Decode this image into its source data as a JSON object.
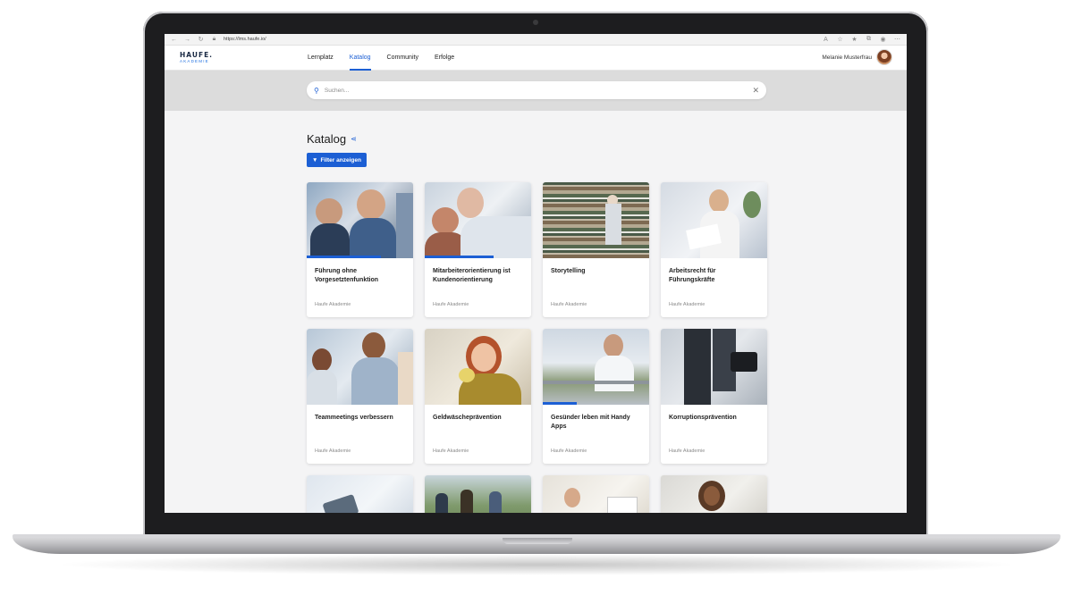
{
  "browser": {
    "url": "https://lms.haufe.io/"
  },
  "header": {
    "logo_top": "HAUFE.",
    "logo_bottom": "AKADEMIE",
    "nav": [
      {
        "label": "Lernplatz",
        "active": false
      },
      {
        "label": "Katalog",
        "active": true
      },
      {
        "label": "Community",
        "active": false
      },
      {
        "label": "Erfolge",
        "active": false
      }
    ],
    "user_name": "Melanie Musterfrau"
  },
  "search": {
    "placeholder": "Suchen..."
  },
  "main": {
    "title": "Katalog",
    "filter_label": "Filter anzeigen",
    "cards": [
      {
        "title": "Führung ohne Vorgesetztenfunktion",
        "provider": "Haufe Akademie",
        "progress": 0.7
      },
      {
        "title": "Mitarbeiterorientierung ist Kundenorientierung",
        "provider": "Haufe Akademie",
        "progress": 0.65
      },
      {
        "title": "Storytelling",
        "provider": "Haufe Akademie",
        "progress": 0
      },
      {
        "title": "Arbeitsrecht für Führungskräfte",
        "provider": "Haufe Akademie",
        "progress": 0
      },
      {
        "title": "Teammeetings verbessern",
        "provider": "Haufe Akademie",
        "progress": 0
      },
      {
        "title": "Geldwäscheprävention",
        "provider": "Haufe Akademie",
        "progress": 0
      },
      {
        "title": "Gesünder leben mit Handy Apps",
        "provider": "Haufe Akademie",
        "progress": 0.32
      },
      {
        "title": "Korruptionsprävention",
        "provider": "Haufe Akademie",
        "progress": 0
      }
    ]
  },
  "colors": {
    "accent": "#1c5fd4",
    "search_band": "#dcdcdc",
    "page_bg": "#f4f4f5"
  }
}
